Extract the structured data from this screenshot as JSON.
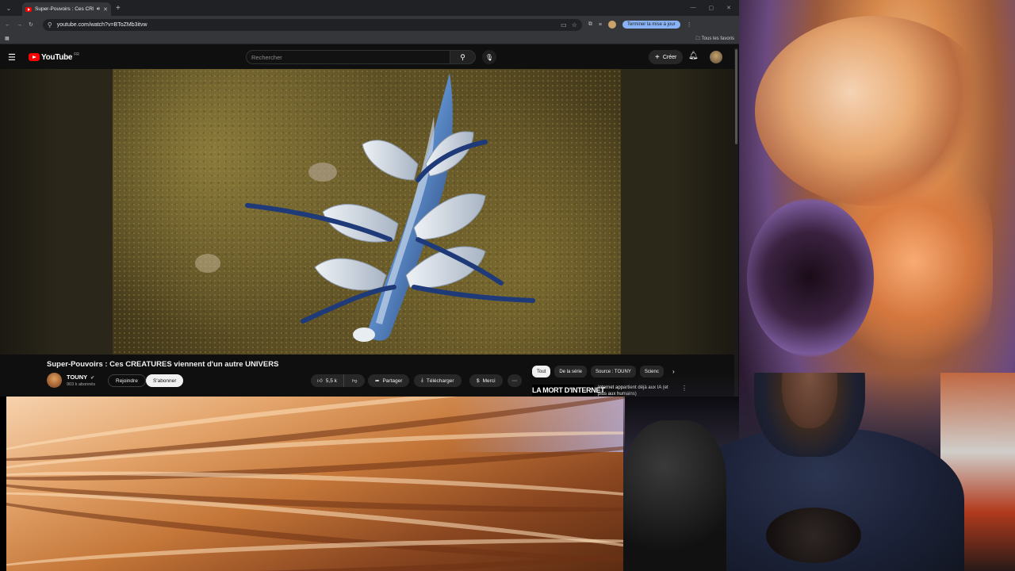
{
  "browser": {
    "tab_title": "Super-Pouvoirs : Ces CREATURES viennent d'un autre UNIVERS",
    "url": "youtube.com/watch?v=BToZMb3itvw",
    "update_button": "Terminer la mise à jour",
    "bookmarks_all": "Tous les favoris"
  },
  "youtube": {
    "logo": "YouTube",
    "logo_region": "FR",
    "search_placeholder": "Rechercher",
    "create_label": "Créer"
  },
  "video": {
    "title": "Super-Pouvoirs : Ces CREATURES viennent d'un autre UNIVERS",
    "channel": "TOUNY",
    "subscribers": "903 k abonnés",
    "join_label": "Rejoindre",
    "subscribe_label": "S'abonner",
    "likes": "5,5 k",
    "share_label": "Partager",
    "download_label": "Télécharger",
    "thanks_label": "Merci"
  },
  "chips": [
    {
      "label": "Tout",
      "active": true
    },
    {
      "label": "De la série",
      "active": false
    },
    {
      "label": "Source : TOUNY",
      "active": false
    },
    {
      "label": "Scienc",
      "active": false
    }
  ],
  "recommendation": {
    "thumb_text": "LA MORT D'INTERNET",
    "title": "Internet appartient déjà aux IA (et plus aux humains)"
  },
  "colors": {
    "youtube_red": "#ff0000",
    "page_bg": "#0f0f0f",
    "update_blue": "#8ab4f8"
  }
}
